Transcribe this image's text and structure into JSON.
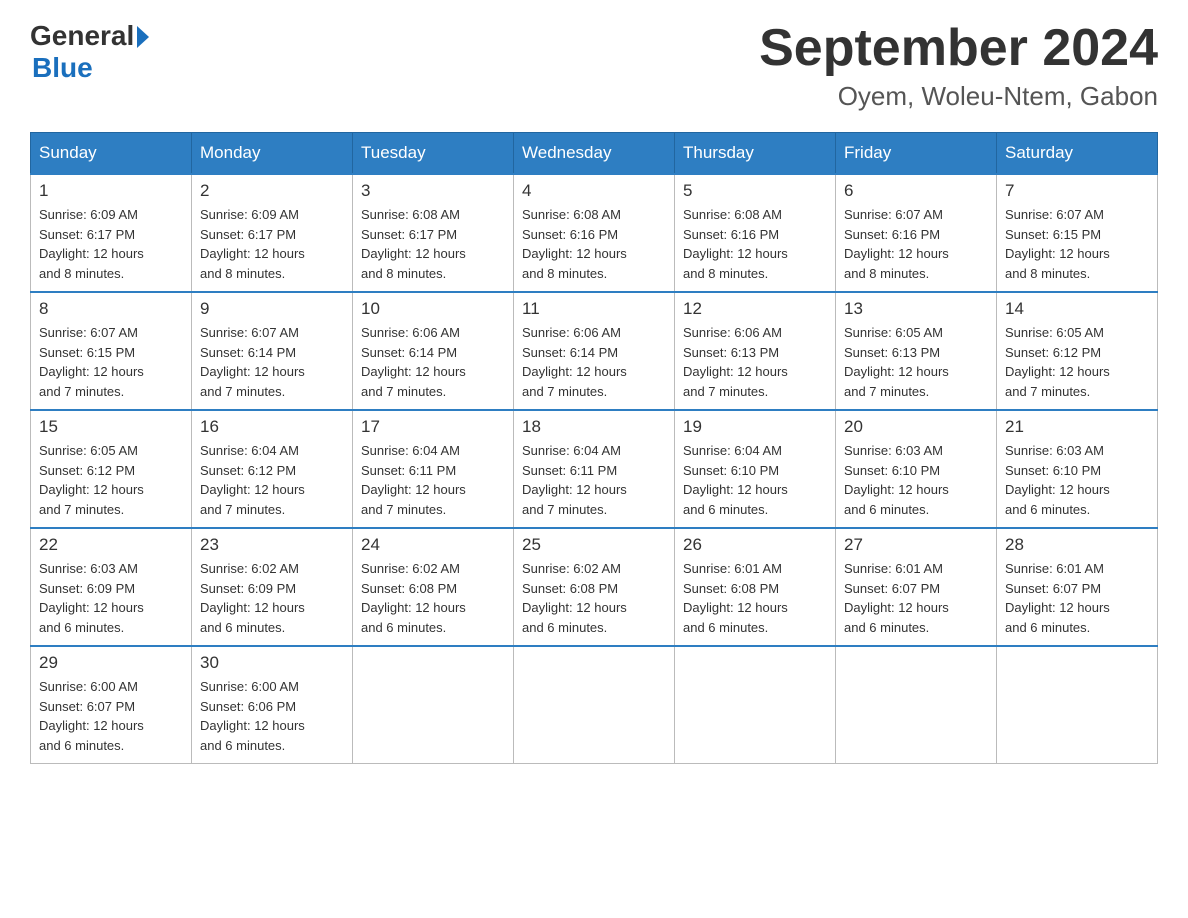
{
  "header": {
    "month_year": "September 2024",
    "location": "Oyem, Woleu-Ntem, Gabon",
    "logo_general": "General",
    "logo_blue": "Blue"
  },
  "days_of_week": [
    "Sunday",
    "Monday",
    "Tuesday",
    "Wednesday",
    "Thursday",
    "Friday",
    "Saturday"
  ],
  "weeks": [
    [
      {
        "day": "1",
        "sunrise": "6:09 AM",
        "sunset": "6:17 PM",
        "daylight": "12 hours and 8 minutes."
      },
      {
        "day": "2",
        "sunrise": "6:09 AM",
        "sunset": "6:17 PM",
        "daylight": "12 hours and 8 minutes."
      },
      {
        "day": "3",
        "sunrise": "6:08 AM",
        "sunset": "6:17 PM",
        "daylight": "12 hours and 8 minutes."
      },
      {
        "day": "4",
        "sunrise": "6:08 AM",
        "sunset": "6:16 PM",
        "daylight": "12 hours and 8 minutes."
      },
      {
        "day": "5",
        "sunrise": "6:08 AM",
        "sunset": "6:16 PM",
        "daylight": "12 hours and 8 minutes."
      },
      {
        "day": "6",
        "sunrise": "6:07 AM",
        "sunset": "6:16 PM",
        "daylight": "12 hours and 8 minutes."
      },
      {
        "day": "7",
        "sunrise": "6:07 AM",
        "sunset": "6:15 PM",
        "daylight": "12 hours and 8 minutes."
      }
    ],
    [
      {
        "day": "8",
        "sunrise": "6:07 AM",
        "sunset": "6:15 PM",
        "daylight": "12 hours and 7 minutes."
      },
      {
        "day": "9",
        "sunrise": "6:07 AM",
        "sunset": "6:14 PM",
        "daylight": "12 hours and 7 minutes."
      },
      {
        "day": "10",
        "sunrise": "6:06 AM",
        "sunset": "6:14 PM",
        "daylight": "12 hours and 7 minutes."
      },
      {
        "day": "11",
        "sunrise": "6:06 AM",
        "sunset": "6:14 PM",
        "daylight": "12 hours and 7 minutes."
      },
      {
        "day": "12",
        "sunrise": "6:06 AM",
        "sunset": "6:13 PM",
        "daylight": "12 hours and 7 minutes."
      },
      {
        "day": "13",
        "sunrise": "6:05 AM",
        "sunset": "6:13 PM",
        "daylight": "12 hours and 7 minutes."
      },
      {
        "day": "14",
        "sunrise": "6:05 AM",
        "sunset": "6:12 PM",
        "daylight": "12 hours and 7 minutes."
      }
    ],
    [
      {
        "day": "15",
        "sunrise": "6:05 AM",
        "sunset": "6:12 PM",
        "daylight": "12 hours and 7 minutes."
      },
      {
        "day": "16",
        "sunrise": "6:04 AM",
        "sunset": "6:12 PM",
        "daylight": "12 hours and 7 minutes."
      },
      {
        "day": "17",
        "sunrise": "6:04 AM",
        "sunset": "6:11 PM",
        "daylight": "12 hours and 7 minutes."
      },
      {
        "day": "18",
        "sunrise": "6:04 AM",
        "sunset": "6:11 PM",
        "daylight": "12 hours and 7 minutes."
      },
      {
        "day": "19",
        "sunrise": "6:04 AM",
        "sunset": "6:10 PM",
        "daylight": "12 hours and 6 minutes."
      },
      {
        "day": "20",
        "sunrise": "6:03 AM",
        "sunset": "6:10 PM",
        "daylight": "12 hours and 6 minutes."
      },
      {
        "day": "21",
        "sunrise": "6:03 AM",
        "sunset": "6:10 PM",
        "daylight": "12 hours and 6 minutes."
      }
    ],
    [
      {
        "day": "22",
        "sunrise": "6:03 AM",
        "sunset": "6:09 PM",
        "daylight": "12 hours and 6 minutes."
      },
      {
        "day": "23",
        "sunrise": "6:02 AM",
        "sunset": "6:09 PM",
        "daylight": "12 hours and 6 minutes."
      },
      {
        "day": "24",
        "sunrise": "6:02 AM",
        "sunset": "6:08 PM",
        "daylight": "12 hours and 6 minutes."
      },
      {
        "day": "25",
        "sunrise": "6:02 AM",
        "sunset": "6:08 PM",
        "daylight": "12 hours and 6 minutes."
      },
      {
        "day": "26",
        "sunrise": "6:01 AM",
        "sunset": "6:08 PM",
        "daylight": "12 hours and 6 minutes."
      },
      {
        "day": "27",
        "sunrise": "6:01 AM",
        "sunset": "6:07 PM",
        "daylight": "12 hours and 6 minutes."
      },
      {
        "day": "28",
        "sunrise": "6:01 AM",
        "sunset": "6:07 PM",
        "daylight": "12 hours and 6 minutes."
      }
    ],
    [
      {
        "day": "29",
        "sunrise": "6:00 AM",
        "sunset": "6:07 PM",
        "daylight": "12 hours and 6 minutes."
      },
      {
        "day": "30",
        "sunrise": "6:00 AM",
        "sunset": "6:06 PM",
        "daylight": "12 hours and 6 minutes."
      },
      null,
      null,
      null,
      null,
      null
    ]
  ],
  "labels": {
    "sunrise": "Sunrise:",
    "sunset": "Sunset:",
    "daylight": "Daylight:"
  }
}
